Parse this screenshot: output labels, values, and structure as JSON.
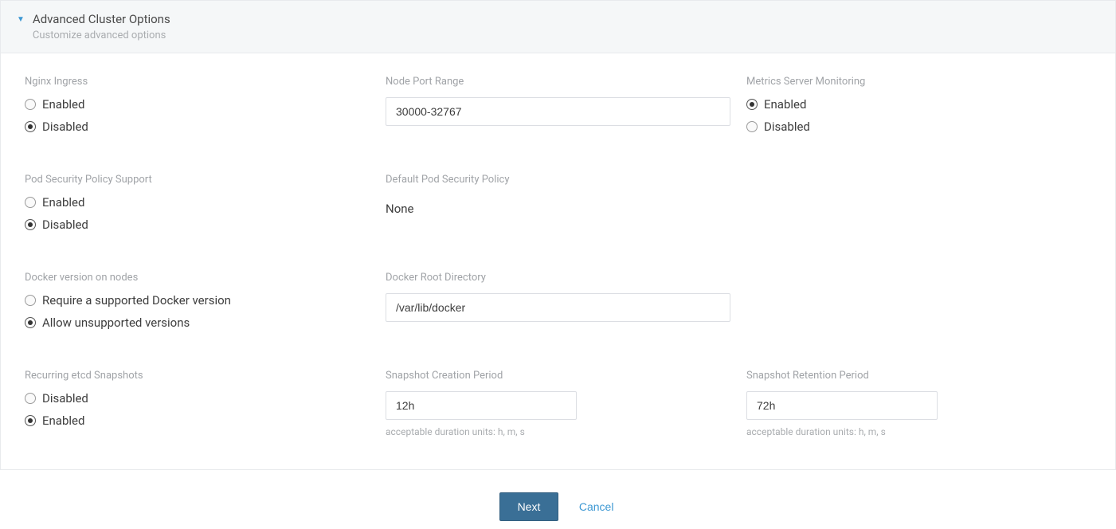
{
  "header": {
    "title": "Advanced Cluster Options",
    "subtitle": "Customize advanced options"
  },
  "nginx_ingress": {
    "label": "Nginx Ingress",
    "enabled": "Enabled",
    "disabled": "Disabled"
  },
  "node_port_range": {
    "label": "Node Port Range",
    "value": "30000-32767"
  },
  "metrics_server": {
    "label": "Metrics Server Monitoring",
    "enabled": "Enabled",
    "disabled": "Disabled"
  },
  "psp_support": {
    "label": "Pod Security Policy Support",
    "enabled": "Enabled",
    "disabled": "Disabled"
  },
  "default_psp": {
    "label": "Default Pod Security Policy",
    "value": "None"
  },
  "docker_version": {
    "label": "Docker version on nodes",
    "require": "Require a supported Docker version",
    "allow": "Allow unsupported versions"
  },
  "docker_root": {
    "label": "Docker Root Directory",
    "value": "/var/lib/docker"
  },
  "etcd_snapshots": {
    "label": "Recurring etcd Snapshots",
    "disabled": "Disabled",
    "enabled": "Enabled"
  },
  "snapshot_creation": {
    "label": "Snapshot Creation Period",
    "value": "12h",
    "hint": "acceptable duration units: h, m, s"
  },
  "snapshot_retention": {
    "label": "Snapshot Retention Period",
    "value": "72h",
    "hint": "acceptable duration units: h, m, s"
  },
  "actions": {
    "next": "Next",
    "cancel": "Cancel"
  }
}
